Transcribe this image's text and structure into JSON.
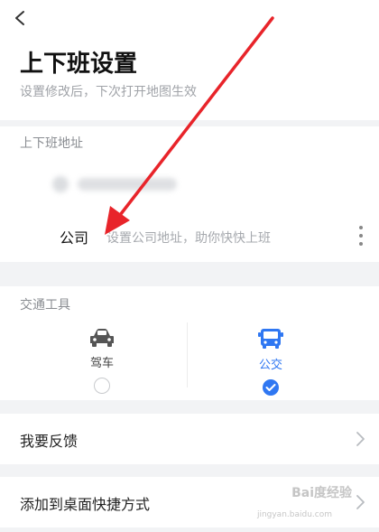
{
  "header": {
    "title": "上下班设置",
    "subtitle": "设置修改后，下次打开地图生效"
  },
  "address": {
    "section_label": "上下班地址",
    "company_label": "公司",
    "company_hint": "设置公司地址，助你快快上班"
  },
  "traffic": {
    "section_label": "交通工具",
    "modes": [
      {
        "label": "驾车",
        "selected": false,
        "icon": "car-icon"
      },
      {
        "label": "公交",
        "selected": true,
        "icon": "bus-icon"
      }
    ]
  },
  "menu": {
    "feedback": "我要反馈",
    "shortcut": "添加到桌面快捷方式"
  },
  "watermark": {
    "brand": "Bai度经验",
    "url": "jingyan.baidu.com"
  },
  "colors": {
    "accent": "#2f77f2",
    "annotation_arrow": "#e8242a"
  }
}
